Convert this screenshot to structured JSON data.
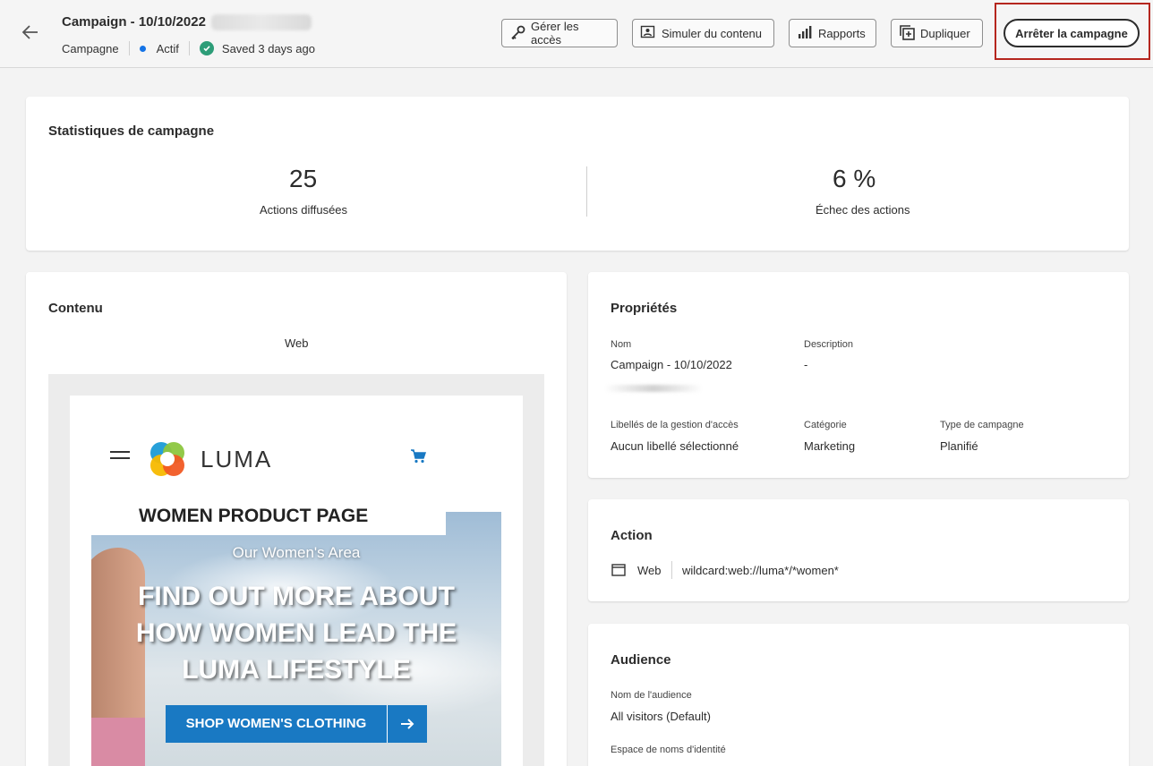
{
  "header": {
    "title": "Campaign - 10/10/2022",
    "type_label": "Campagne",
    "status_label": "Actif",
    "saved_label": "Saved 3 days ago",
    "buttons": {
      "manage_access": "Gérer les accès",
      "simulate": "Simuler du contenu",
      "reports": "Rapports",
      "duplicate": "Dupliquer",
      "stop": "Arrêter la campagne"
    },
    "colors": {
      "status_dot": "#1473e6",
      "saved_check": "#2d9d78",
      "highlight": "#b5261e"
    }
  },
  "stats": {
    "title": "Statistiques de campagne",
    "items": [
      {
        "value": "25",
        "label": "Actions diffusées"
      },
      {
        "value": "6 %",
        "label": "Échec des actions"
      }
    ]
  },
  "content": {
    "title": "Contenu",
    "channel": "Web",
    "preview": {
      "brand": "LUMA",
      "page_title": "WOMEN PRODUCT PAGE",
      "hero_subtitle": "Our Women's Area",
      "hero_title": "FIND OUT MORE ABOUT HOW WOMEN LEAD THE LUMA LIFESTYLE",
      "cta_label": "SHOP WOMEN'S CLOTHING",
      "cta_color": "#1979c3"
    }
  },
  "properties": {
    "title": "Propriétés",
    "name_label": "Nom",
    "name_value": "Campaign - 10/10/2022",
    "description_label": "Description",
    "description_value": "-",
    "access_label": "Libellés de la gestion d'accès",
    "access_value": "Aucun libellé sélectionné",
    "category_label": "Catégorie",
    "category_value": "Marketing",
    "campaign_type_label": "Type de campagne",
    "campaign_type_value": "Planifié"
  },
  "action": {
    "title": "Action",
    "channel": "Web",
    "surface": "wildcard:web://luma*/*women*"
  },
  "audience": {
    "title": "Audience",
    "name_label": "Nom de l'audience",
    "name_value": "All visitors (Default)",
    "namespace_label": "Espace de noms d'identité"
  },
  "icons": [
    "back-arrow-icon",
    "key-icon",
    "simulate-icon",
    "chart-icon",
    "duplicate-icon",
    "check-icon",
    "hamburger-icon",
    "cart-icon",
    "arrow-right-icon",
    "web-channel-icon"
  ]
}
